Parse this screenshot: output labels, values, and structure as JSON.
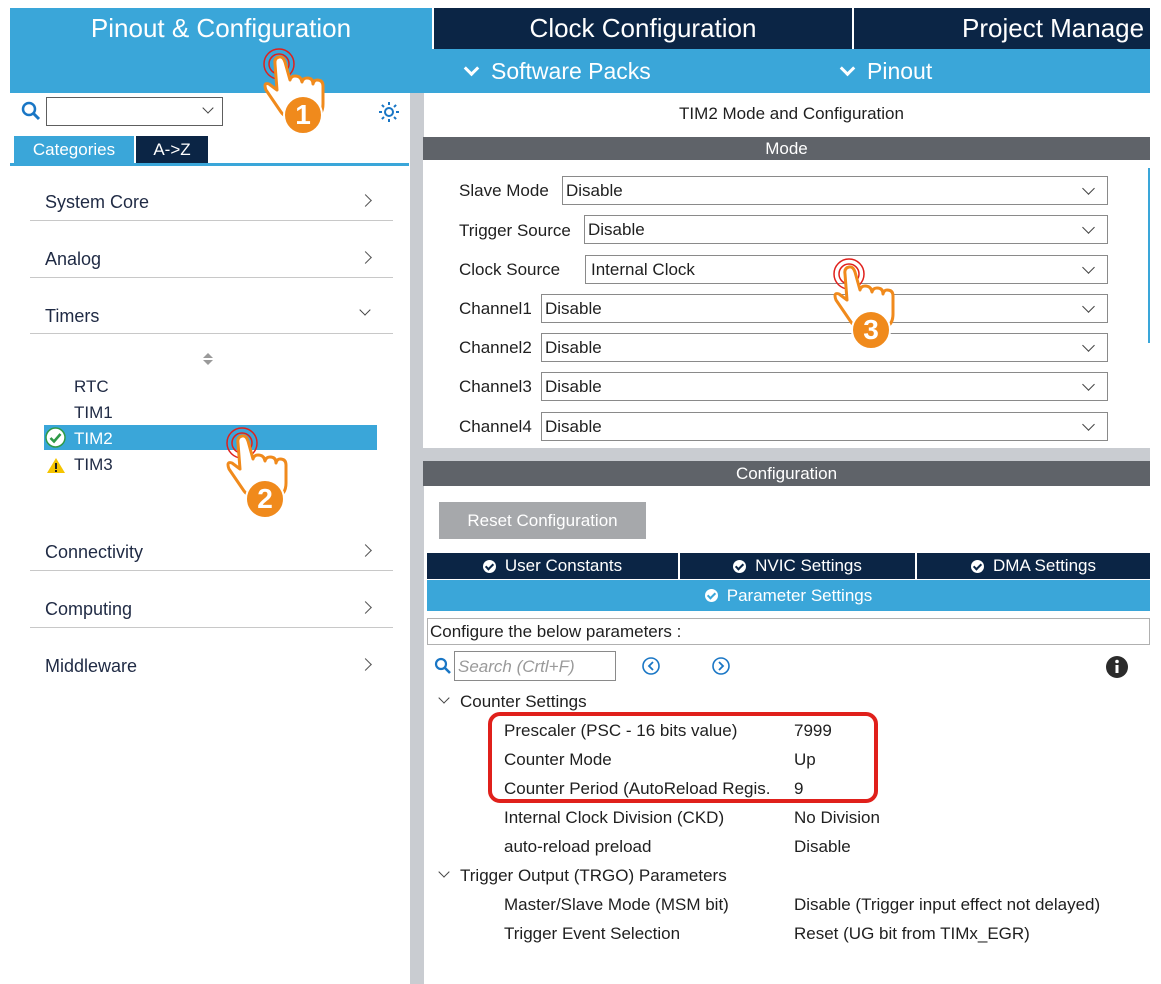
{
  "top_tabs": [
    {
      "label": "Pinout & Configuration"
    },
    {
      "label": "Clock Configuration"
    },
    {
      "label": "Project Manage"
    }
  ],
  "subbar": {
    "software_packs": "Software Packs",
    "pinout": "Pinout"
  },
  "left_panel": {
    "search": {
      "value": ""
    },
    "tabs": [
      {
        "label": "Categories"
      },
      {
        "label": "A->Z"
      }
    ],
    "categories": [
      {
        "label": "System Core"
      },
      {
        "label": "Analog"
      },
      {
        "label": "Timers"
      },
      {
        "label": "Connectivity"
      },
      {
        "label": "Computing"
      },
      {
        "label": "Middleware"
      }
    ],
    "timers": [
      {
        "label": "RTC"
      },
      {
        "label": "TIM1"
      },
      {
        "label": "TIM2"
      },
      {
        "label": "TIM3"
      }
    ]
  },
  "right_panel": {
    "title": "TIM2 Mode and Configuration",
    "mode_header": "Mode",
    "mode_fields": [
      {
        "label": "Slave Mode",
        "value": "Disable"
      },
      {
        "label": "Trigger Source",
        "value": "Disable"
      },
      {
        "label": "Clock Source",
        "value": "Internal Clock"
      },
      {
        "label": "Channel1",
        "value": "Disable"
      },
      {
        "label": "Channel2",
        "value": "Disable"
      },
      {
        "label": "Channel3",
        "value": "Disable"
      },
      {
        "label": "Channel4",
        "value": "Disable"
      }
    ],
    "config_header": "Configuration",
    "reset_button": "Reset Configuration",
    "config_tabs": [
      {
        "label": "User Constants"
      },
      {
        "label": "NVIC Settings"
      },
      {
        "label": "DMA Settings"
      }
    ],
    "parameter_tab": "Parameter Settings",
    "configure_text": "Configure the below parameters :",
    "search_placeholder": "Search (Crtl+F)",
    "groups": [
      {
        "title": "Counter Settings",
        "params": [
          {
            "name": "Prescaler (PSC - 16 bits value)",
            "value": "7999"
          },
          {
            "name": "Counter Mode",
            "value": "Up"
          },
          {
            "name": "Counter Period (AutoReload Regis.",
            "value": "9"
          },
          {
            "name": "Internal Clock Division (CKD)",
            "value": "No Division"
          },
          {
            "name": "auto-reload preload",
            "value": "Disable"
          }
        ]
      },
      {
        "title": "Trigger Output (TRGO) Parameters",
        "params": [
          {
            "name": "Master/Slave Mode (MSM bit)",
            "value": "Disable (Trigger input effect not delayed)"
          },
          {
            "name": "Trigger Event Selection",
            "value": "Reset (UG bit from TIMx_EGR)"
          }
        ]
      }
    ]
  },
  "annotations": [
    {
      "step": "1"
    },
    {
      "step": "2"
    },
    {
      "step": "3"
    }
  ],
  "colors": {
    "accent_blue": "#3aa6d9",
    "dark_navy": "#0b2545",
    "section_gray": "#5f6369",
    "highlight_red": "#e0201b",
    "hand_orange": "#f08a1c"
  }
}
